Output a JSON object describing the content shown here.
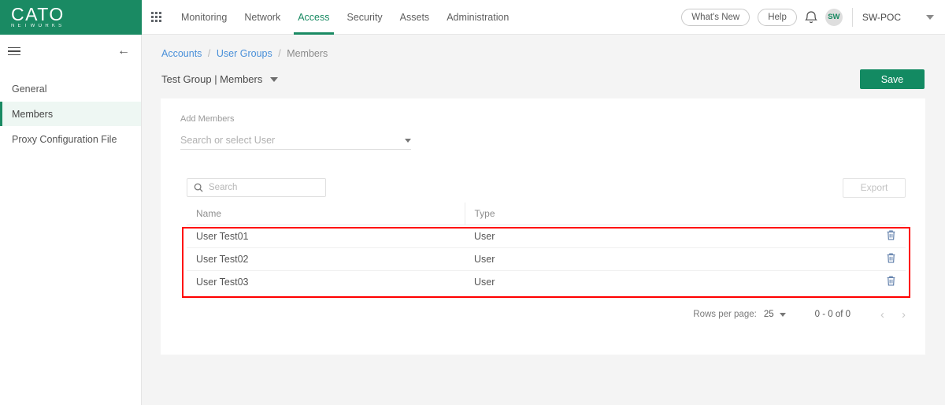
{
  "brand": {
    "logo_main": "CATO",
    "logo_sub": "NETWORKS",
    "green": "#1a8a63"
  },
  "topnav": {
    "apps_icon": "app-grid-icon",
    "items": [
      {
        "label": "Monitoring",
        "active": false
      },
      {
        "label": "Network",
        "active": false
      },
      {
        "label": "Access",
        "active": true
      },
      {
        "label": "Security",
        "active": false
      },
      {
        "label": "Assets",
        "active": false
      },
      {
        "label": "Administration",
        "active": false
      }
    ],
    "whats_new": "What's New",
    "help": "Help",
    "bell_icon": "notification-bell-icon",
    "avatar_initials": "SW",
    "account": "SW-POC",
    "account_caret": "chevron-down-icon"
  },
  "sidebar": {
    "menu_icon": "hamburger-menu-icon",
    "collapse_icon": "back-arrow-icon",
    "items": [
      {
        "label": "General",
        "active": false
      },
      {
        "label": "Members",
        "active": true
      },
      {
        "label": "Proxy Configuration File",
        "active": false
      }
    ]
  },
  "breadcrumb": {
    "accounts": "Accounts",
    "user_groups": "User Groups",
    "current": "Members",
    "separator": "/"
  },
  "header": {
    "title": "Test Group | Members",
    "save_label": "Save"
  },
  "add_members": {
    "label": "Add Members",
    "placeholder": "Search or select User"
  },
  "toolbar": {
    "search_placeholder": "Search",
    "search_value": "",
    "search_icon": "search-icon",
    "export_label": "Export"
  },
  "table": {
    "columns": [
      "Name",
      "Type"
    ],
    "rows": [
      {
        "name": "User Test01",
        "type": "User",
        "delete_icon": "trash-icon"
      },
      {
        "name": "User Test02",
        "type": "User",
        "delete_icon": "trash-icon"
      },
      {
        "name": "User Test03",
        "type": "User",
        "delete_icon": "trash-icon"
      }
    ]
  },
  "pagination": {
    "rows_per_page_label": "Rows per page:",
    "rows_per_page_value": "25",
    "range": "0 - 0 of 0",
    "prev_icon": "chevron-left-icon",
    "next_icon": "chevron-right-icon",
    "prev_glyph": "‹",
    "next_glyph": "›"
  },
  "annotation": {
    "type": "highlight-rectangle",
    "color": "#ff0000"
  }
}
